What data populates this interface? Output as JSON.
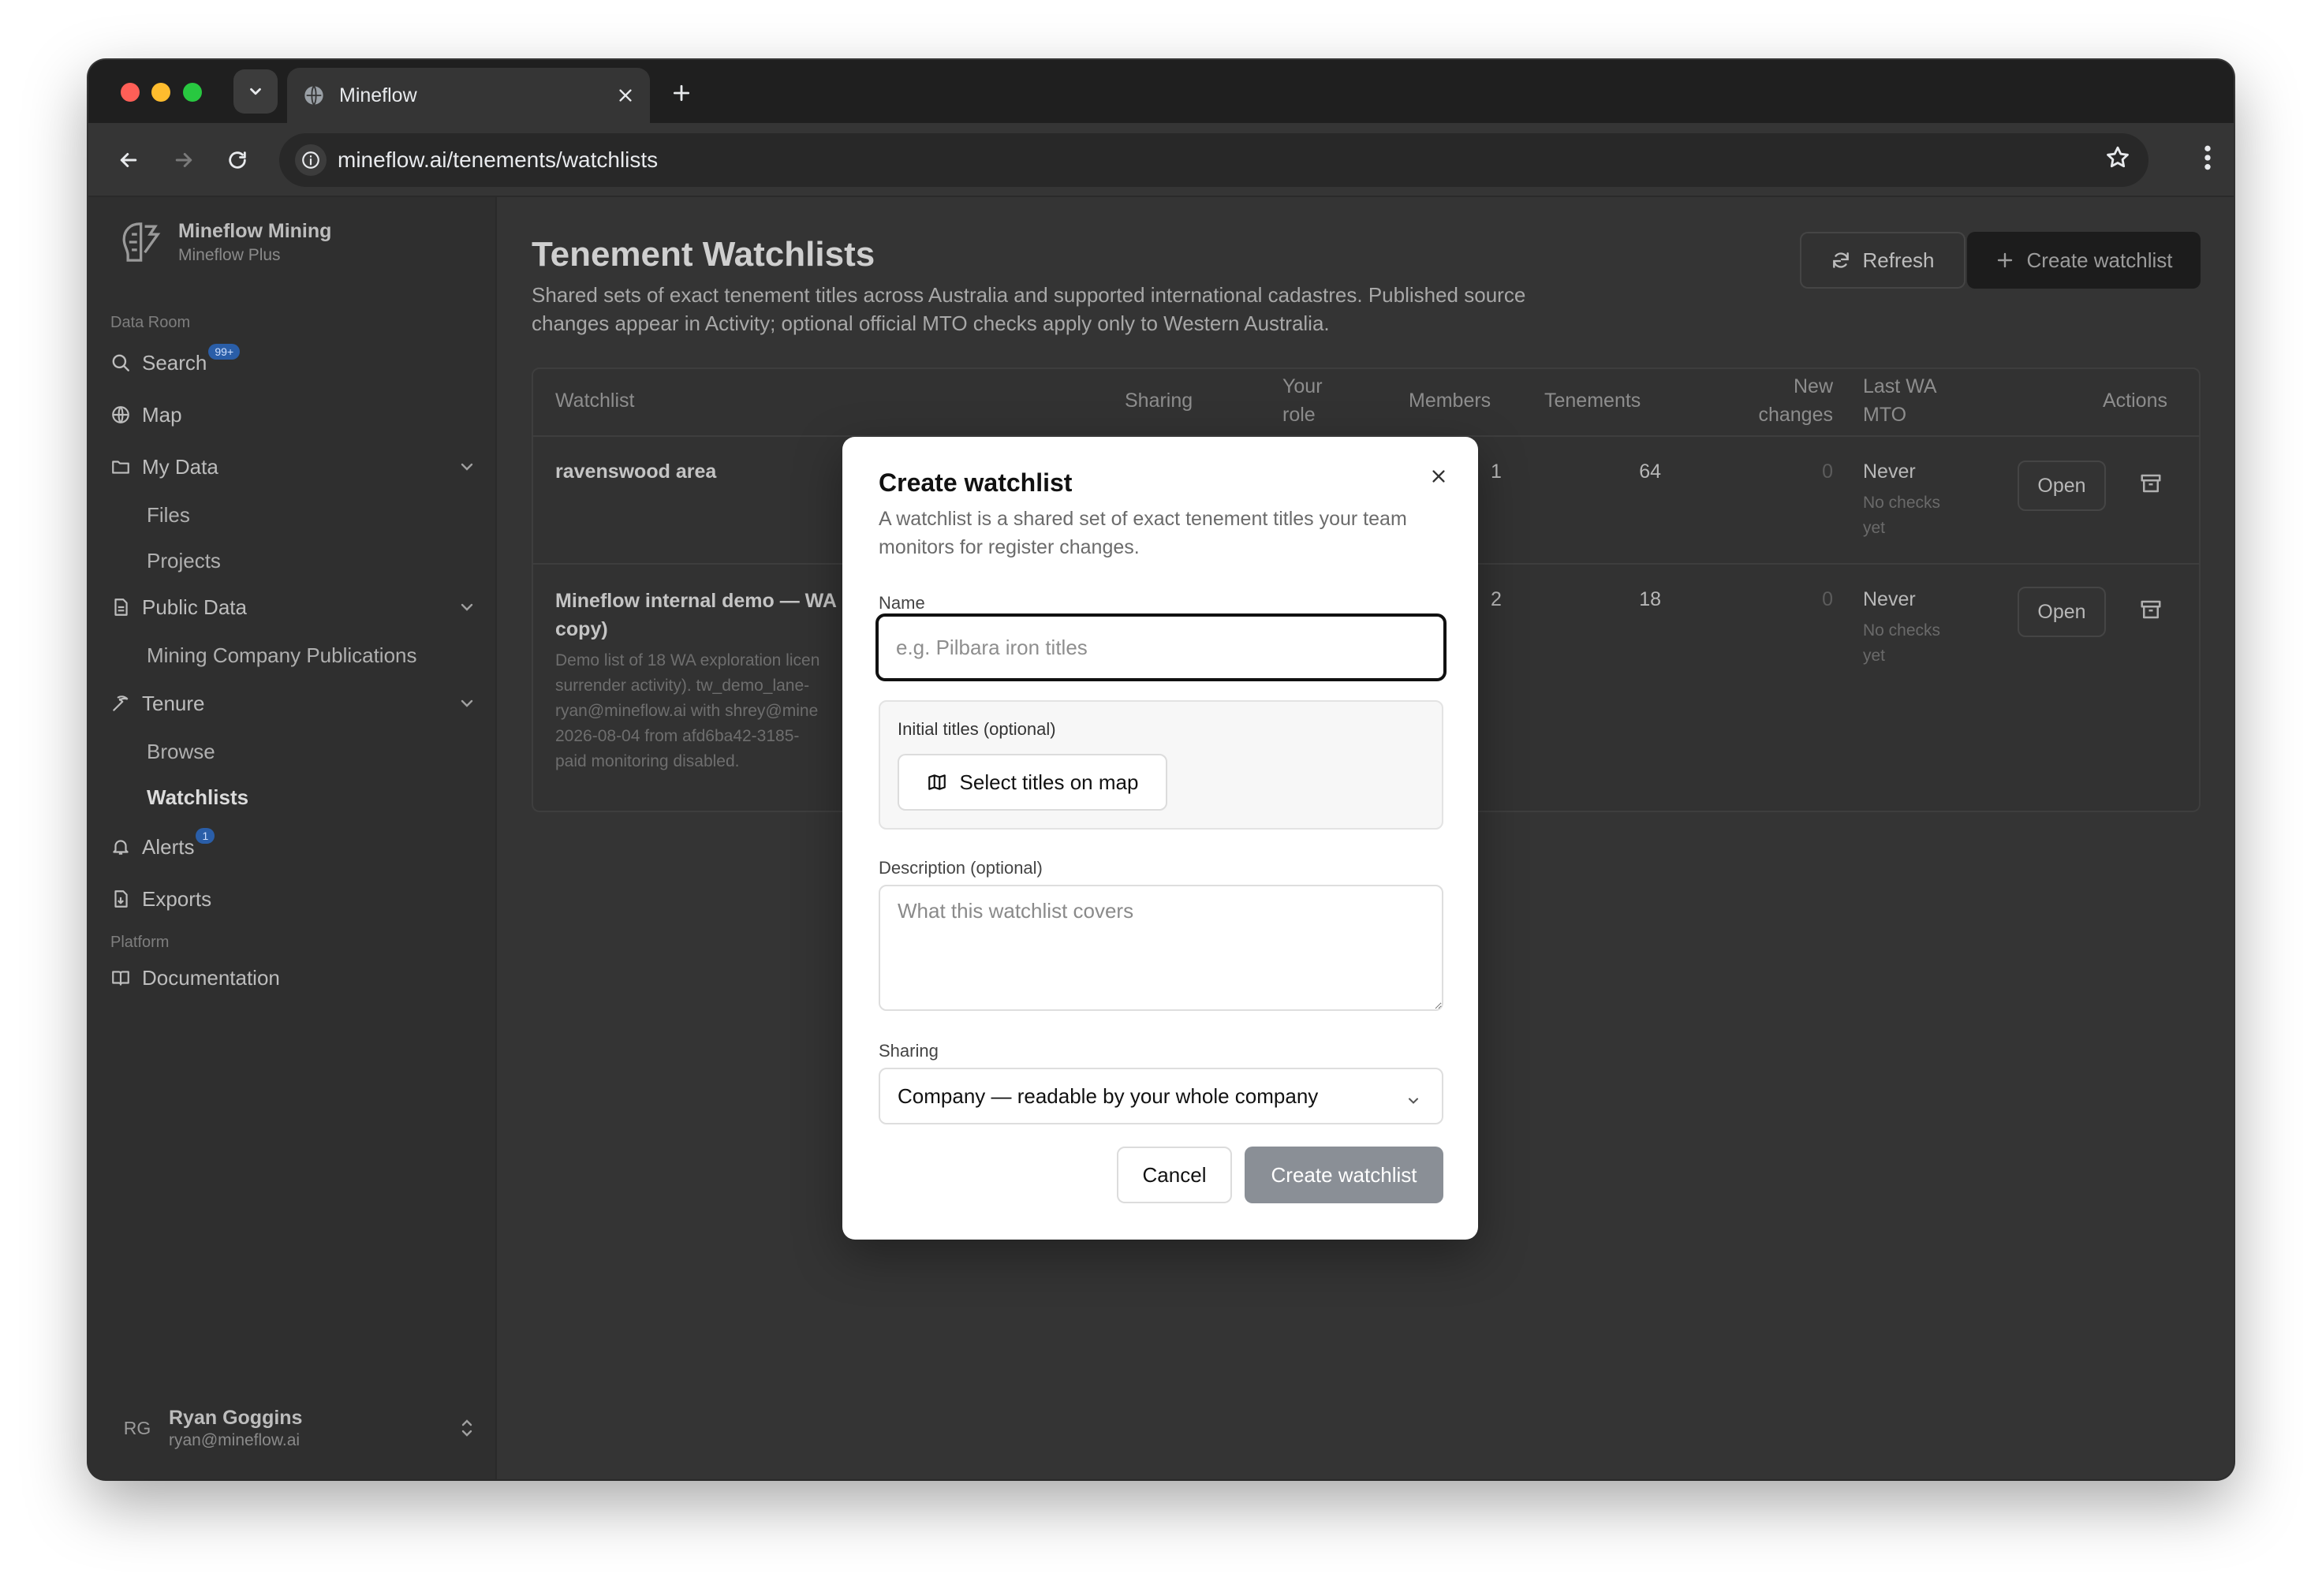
{
  "browser": {
    "tab_title": "Mineflow",
    "url": "mineflow.ai/tenements/watchlists"
  },
  "sidebar": {
    "org_name": "Mineflow Mining",
    "org_plan": "Mineflow Plus",
    "section_data_room": "Data Room",
    "search": "Search",
    "search_badge": "99+",
    "map": "Map",
    "my_data": "My Data",
    "files": "Files",
    "projects": "Projects",
    "public_data": "Public Data",
    "mining_pubs": "Mining Company Publications",
    "tenure": "Tenure",
    "browse": "Browse",
    "watchlists": "Watchlists",
    "alerts": "Alerts",
    "alerts_badge": "1",
    "exports": "Exports",
    "section_platform": "Platform",
    "documentation": "Documentation",
    "user_initials": "RG",
    "user_name": "Ryan Goggins",
    "user_email": "ryan@mineflow.ai"
  },
  "main": {
    "title": "Tenement Watchlists",
    "description": "Shared sets of exact tenement titles across Australia and supported international cadastres. Published source changes appear in Activity; optional official MTO checks apply only to Western Australia.",
    "refresh_label": "Refresh",
    "create_label": "Create watchlist",
    "table": {
      "headers": {
        "watchlist": "Watchlist",
        "sharing": "Sharing",
        "role1": "Your",
        "role2": "role",
        "members": "Members",
        "tenements": "Tenements",
        "new1": "New",
        "new2": "changes",
        "mto1": "Last WA",
        "mto2": "MTO",
        "actions": "Actions"
      },
      "rows": [
        {
          "name": "ravenswood area",
          "members": "1",
          "tenements": "64",
          "new_changes": "0",
          "last_mto": "Never",
          "mto_note1": "No checks",
          "mto_note2": "yet",
          "open": "Open"
        },
        {
          "name1": "Mineflow internal demo — WA",
          "name2": "copy)",
          "desc1": "Demo list of 18 WA exploration licen",
          "desc2": "surrender activity). tw_demo_lane-",
          "desc3": "ryan@mineflow.ai with shrey@mine",
          "desc4": "2026-08-04 from afd6ba42-3185-",
          "desc5": "paid monitoring disabled.",
          "members": "2",
          "tenements": "18",
          "new_changes": "0",
          "last_mto": "Never",
          "mto_note1": "No checks",
          "mto_note2": "yet",
          "open": "Open"
        }
      ]
    }
  },
  "modal": {
    "title": "Create watchlist",
    "subtitle": "A watchlist is a shared set of exact tenement titles your team monitors for register changes.",
    "name_label": "Name",
    "name_placeholder": "e.g. Pilbara iron titles",
    "initial_titles_label": "Initial titles (optional)",
    "select_titles_label": "Select titles on map",
    "description_label": "Description (optional)",
    "description_placeholder": "What this watchlist covers",
    "sharing_label": "Sharing",
    "sharing_value": "Company — readable by your whole company",
    "cancel_label": "Cancel",
    "create_label": "Create watchlist"
  }
}
